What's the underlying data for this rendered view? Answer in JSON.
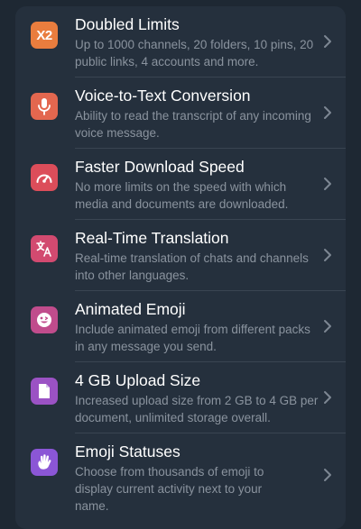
{
  "features": [
    {
      "title": "Doubled Limits",
      "description": "Up to 1000 channels, 20 folders, 10 pins, 20 public links, 4 accounts and more.",
      "icon_name": "doubled-limits-icon",
      "icon_text": "X2",
      "color": "#e97d3e"
    },
    {
      "title": "Voice-to-Text Conversion",
      "description": "Ability to read the transcript of any incoming voice message.",
      "icon_name": "microphone-icon",
      "color": "#e3674f"
    },
    {
      "title": "Faster Download Speed",
      "description": "No more limits on the speed with which media and documents are downloaded.",
      "icon_name": "speedometer-icon",
      "color": "#dc4d5a"
    },
    {
      "title": "Real-Time Translation",
      "description": "Real-time translation of chats and channels into other languages.",
      "icon_name": "translate-icon",
      "color": "#d24a70"
    },
    {
      "title": "Animated Emoji",
      "description": "Include animated emoji from different packs in any message you send.",
      "icon_name": "emoji-face-icon",
      "color": "#c04c8c"
    },
    {
      "title": "4 GB Upload Size",
      "description": "Increased upload size from 2 GB to 4 GB per document, unlimited storage overall.",
      "icon_name": "document-icon",
      "color": "#9b52c4"
    },
    {
      "title": "Emoji Statuses",
      "description": "Choose from thousands of emoji to display current activity next to your name.",
      "icon_name": "waving-hand-icon",
      "color": "#8b56d6"
    }
  ]
}
